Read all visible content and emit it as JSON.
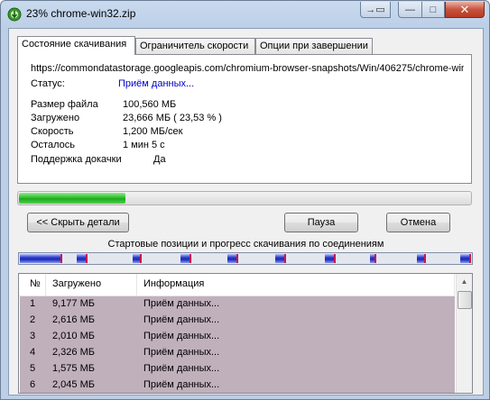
{
  "window": {
    "title": "23% chrome-win32.zip",
    "close_glyph": "✕",
    "maximize_glyph": "□",
    "minimize_glyph": "—",
    "extra_glyph": "→▭"
  },
  "tabs": [
    {
      "label": "Состояние скачивания"
    },
    {
      "label": "Ограничитель скорости"
    },
    {
      "label": "Опции при завершении"
    }
  ],
  "details": {
    "url": "https://commondatastorage.googleapis.com/chromium-browser-snapshots/Win/406275/chrome-win",
    "status_label": "Статус:",
    "status_value": "Приём данных...",
    "rows": [
      {
        "label": "Размер файла",
        "value": "100,560  МБ"
      },
      {
        "label": "Загружено",
        "value": "23,666  МБ  ( 23,53 % )"
      },
      {
        "label": "Скорость",
        "value": "1,200  МБ/сек"
      },
      {
        "label": "Осталось",
        "value": "1 мин 5 с"
      },
      {
        "label": "Поддержка докачки",
        "value": "Да"
      }
    ]
  },
  "progress": {
    "percent": 23.53,
    "color": "#2ec22b"
  },
  "buttons": {
    "hide_details": "<< Скрыть детали",
    "pause": "Пауза",
    "cancel": "Отмена"
  },
  "connections": {
    "caption": "Стартовые позиции и прогресс скачивания по соединениям",
    "segments": [
      {
        "start": 0,
        "progress": 0.09
      },
      {
        "start": 0.125,
        "progress": 0.02
      },
      {
        "start": 0.25,
        "progress": 0.015
      },
      {
        "start": 0.355,
        "progress": 0.02
      },
      {
        "start": 0.46,
        "progress": 0.02
      },
      {
        "start": 0.565,
        "progress": 0.02
      },
      {
        "start": 0.675,
        "progress": 0.02
      },
      {
        "start": 0.775,
        "progress": 0.01
      },
      {
        "start": 0.88,
        "progress": 0.015
      },
      {
        "start": 0.975,
        "progress": 0.02
      }
    ]
  },
  "list": {
    "columns": [
      "№",
      "Загружено",
      "Информация"
    ],
    "rows": [
      {
        "num": "1",
        "loaded": "9,177  МБ",
        "info": "Приём данных..."
      },
      {
        "num": "2",
        "loaded": "2,616  МБ",
        "info": "Приём данных..."
      },
      {
        "num": "3",
        "loaded": "2,010  МБ",
        "info": "Приём данных..."
      },
      {
        "num": "4",
        "loaded": "2,326  МБ",
        "info": "Приём данных..."
      },
      {
        "num": "5",
        "loaded": "1,575  МБ",
        "info": "Приём данных..."
      },
      {
        "num": "6",
        "loaded": "2,045  МБ",
        "info": "Приём данных..."
      }
    ],
    "row_color": "#c0b0bc"
  }
}
